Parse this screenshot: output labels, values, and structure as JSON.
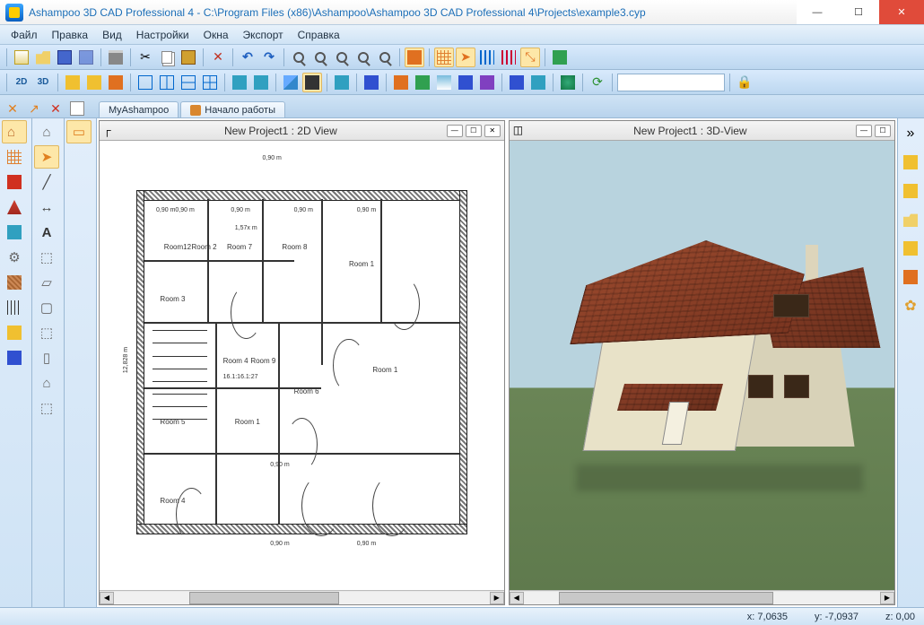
{
  "title": "Ashampoo 3D CAD Professional 4 - C:\\Program Files (x86)\\Ashampoo\\Ashampoo 3D CAD Professional 4\\Projects\\example3.cyp",
  "menu": {
    "file": "Файл",
    "edit": "Правка",
    "view": "Вид",
    "settings": "Настройки",
    "windows": "Окна",
    "export": "Экспорт",
    "help": "Справка"
  },
  "toolbar2": {
    "mode2d": "2D",
    "mode3d": "3D"
  },
  "tabs": {
    "myashampoo": "MyAshampoo",
    "start": "Начало работы"
  },
  "views": {
    "v2d_title": "New Project1 : 2D View",
    "v3d_title": "New Project1 : 3D-View"
  },
  "rooms": {
    "r1": "Room 1",
    "r12": "Room12",
    "r2": "Room 2",
    "r3": "Room 3",
    "r4": "Room 4",
    "r4b": "Room 4",
    "r5": "Room 5",
    "r6": "Room 6",
    "r7": "Room 7",
    "r8": "Room 8",
    "r9": "Room 9",
    "r1b": "Room 1",
    "r1c": "Room 1"
  },
  "dims": {
    "d1": "0,90 m",
    "d2": "0,90 m",
    "d3": "0,90 m",
    "d4": "0,90 m",
    "d5": "0,90 m",
    "d6": "0,90 m",
    "d7": "0,90 m",
    "d8": "1,57x m",
    "d9": "12,828 m",
    "d10": "0,90 m0,90 m",
    "d11": "16.1:16.1:27"
  },
  "status": {
    "x": "x: 7,0635",
    "y": "y: -7,0937",
    "z": "z: 0,00"
  }
}
